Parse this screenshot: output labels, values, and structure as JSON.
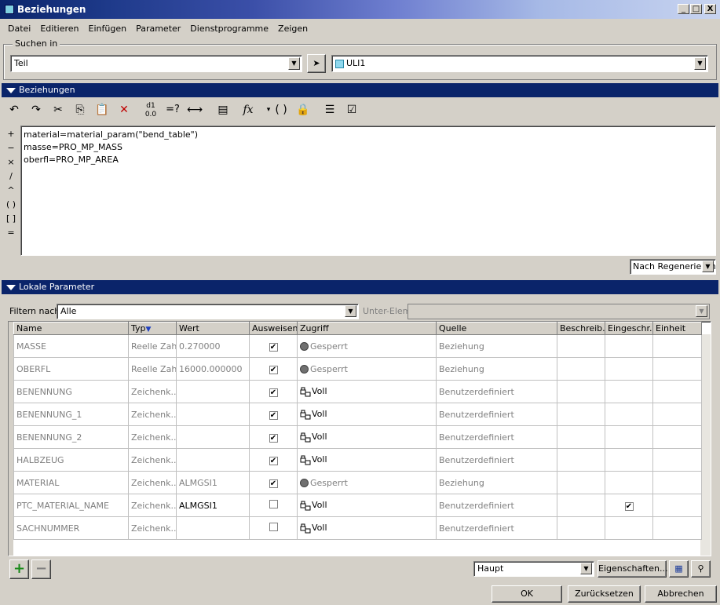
{
  "window": {
    "title": "Beziehungen",
    "btn_min": "_",
    "btn_max": "□",
    "btn_close": "X"
  },
  "menu": [
    "Datei",
    "Editieren",
    "Einfügen",
    "Parameter",
    "Dienstprogramme",
    "Zeigen"
  ],
  "search": {
    "group_label": "Suchen in",
    "type_value": "Teil",
    "object_value": "ULI1"
  },
  "relations": {
    "section_title": "Beziehungen",
    "lines": [
      "material=material_param(\"bend_table\")",
      "masse=PRO_MP_MASS",
      "oberfl=PRO_MP_AREA"
    ],
    "operators": [
      "+",
      "−",
      "×",
      "/",
      "^",
      "( )",
      "[ ]",
      "="
    ],
    "regen_option": "Nach Regenerierung"
  },
  "params": {
    "section_title": "Lokale Parameter",
    "filter_label": "Filtern nach",
    "filter_value": "Alle",
    "subelem_label": "Unter-Elem",
    "columns": [
      "Name",
      "Typ",
      "Wert",
      "Ausweisen",
      "Zugriff",
      "Quelle",
      "Beschreib...",
      "Eingeschr...",
      "Einheit"
    ],
    "rows": [
      {
        "name": "MASSE",
        "typ": "Reelle Zahl",
        "wert": "0.270000",
        "ausweisen": true,
        "zugriff": "Gesperrt",
        "locked": true,
        "quelle": "Beziehung",
        "eingeschr": false,
        "wert_dark": false
      },
      {
        "name": "OBERFL",
        "typ": "Reelle Zahl",
        "wert": "16000.000000",
        "ausweisen": true,
        "zugriff": "Gesperrt",
        "locked": true,
        "quelle": "Beziehung",
        "eingeschr": false,
        "wert_dark": false
      },
      {
        "name": "BENENNUNG",
        "typ": "Zeichenk...",
        "wert": "",
        "ausweisen": true,
        "zugriff": "Voll",
        "locked": false,
        "quelle": "Benutzerdefiniert",
        "eingeschr": false,
        "wert_dark": false
      },
      {
        "name": "BENENNUNG_1",
        "typ": "Zeichenk...",
        "wert": "",
        "ausweisen": true,
        "zugriff": "Voll",
        "locked": false,
        "quelle": "Benutzerdefiniert",
        "eingeschr": false,
        "wert_dark": false
      },
      {
        "name": "BENENNUNG_2",
        "typ": "Zeichenk...",
        "wert": "",
        "ausweisen": true,
        "zugriff": "Voll",
        "locked": false,
        "quelle": "Benutzerdefiniert",
        "eingeschr": false,
        "wert_dark": false
      },
      {
        "name": "HALBZEUG",
        "typ": "Zeichenk...",
        "wert": "",
        "ausweisen": true,
        "zugriff": "Voll",
        "locked": false,
        "quelle": "Benutzerdefiniert",
        "eingeschr": false,
        "wert_dark": false
      },
      {
        "name": "MATERIAL",
        "typ": "Zeichenk...",
        "wert": "ALMGSI1",
        "ausweisen": true,
        "zugriff": "Gesperrt",
        "locked": true,
        "quelle": "Beziehung",
        "eingeschr": false,
        "wert_dark": false
      },
      {
        "name": "PTC_MATERIAL_NAME",
        "typ": "Zeichenk...",
        "wert": "ALMGSI1",
        "ausweisen": false,
        "zugriff": "Voll",
        "locked": false,
        "quelle": "Benutzerdefiniert",
        "eingeschr": true,
        "wert_dark": true
      },
      {
        "name": "SACHNUMMER",
        "typ": "Zeichenk...",
        "wert": "",
        "ausweisen": false,
        "zugriff": "Voll",
        "locked": false,
        "quelle": "Benutzerdefiniert",
        "eingeschr": false,
        "wert_dark": false
      }
    ],
    "view_value": "Haupt",
    "properties_label": "Eigenschaften..."
  },
  "footer": {
    "ok": "OK",
    "reset": "Zurücksetzen",
    "cancel": "Abbrechen"
  }
}
